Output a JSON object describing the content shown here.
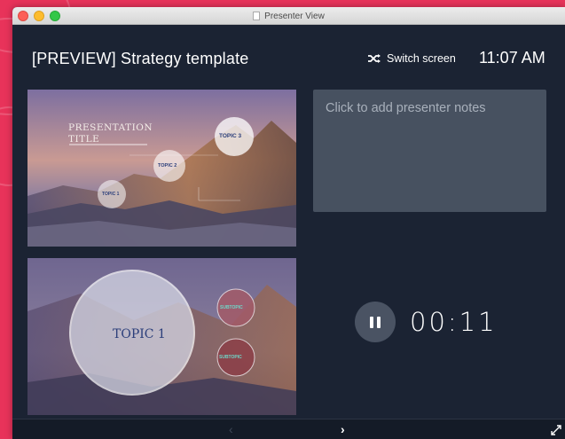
{
  "window": {
    "title": "Presenter View"
  },
  "header": {
    "title": "[PREVIEW] Strategy template",
    "switch_screen_label": "Switch screen",
    "clock": "11:07 AM"
  },
  "current_slide": {
    "title_line1": "PRESENTATION",
    "title_line2": "TITLE",
    "topics": [
      "TOPIC 1",
      "TOPIC 2",
      "TOPIC 3"
    ]
  },
  "next_slide": {
    "topic": "TOPIC 1",
    "subtopic_labels": [
      "SUBTOPIC",
      "SUBTOPIC"
    ]
  },
  "notes": {
    "placeholder": "Click to add presenter notes"
  },
  "timer": {
    "value": "00:11",
    "state": "running"
  },
  "navigation": {
    "prev_symbol": "‹",
    "next_symbol": "›"
  },
  "colors": {
    "background": "#e8335a",
    "window": "#1b2333",
    "notes_panel": "#475160",
    "accent_topic": "#2b3e7a"
  },
  "icons": [
    "shuffle-icon",
    "pause-icon",
    "chevron-left-icon",
    "chevron-right-icon",
    "expand-icon"
  ]
}
